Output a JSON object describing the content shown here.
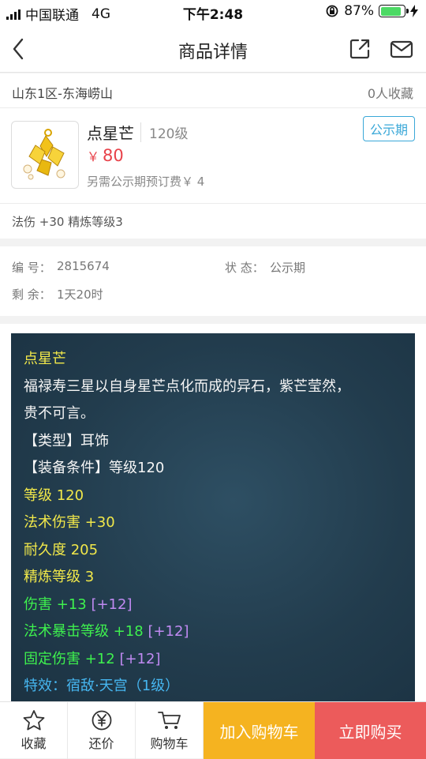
{
  "status_bar": {
    "carrier": "中国联通",
    "network": "4G",
    "time": "下午2:48",
    "battery": "87%",
    "battery_level": 0.87
  },
  "nav": {
    "title": "商品详情"
  },
  "product": {
    "server": "山东1区-东海崂山",
    "favorites": "0人收藏",
    "name": "点星芒",
    "level": "120级",
    "badge": "公示期",
    "currency": "￥",
    "price": "80",
    "fee_note": "另需公示期预订费￥ 4",
    "attrs": "法伤 +30 精炼等级3"
  },
  "info": {
    "id_label": "编 号：",
    "id_value": "2815674",
    "status_label": "状 态：",
    "status_value": "公示期",
    "remaining_label": "剩 余：",
    "remaining_value": "1天20时"
  },
  "description": {
    "title": "点星芒",
    "lore1": "福禄寿三星以自身星芒点化而成的异石，紫芒莹然，",
    "lore2": "贵不可言。",
    "type": "【类型】耳饰",
    "req": "【装备条件】等级120",
    "level": "等级 120",
    "magic_dmg": "法术伤害 +30",
    "durability": "耐久度 205",
    "refine": "精炼等级 3",
    "dmg": "伤害 +13",
    "dmg_bonus": "[+12]",
    "crit": "法术暴击等级 +18",
    "crit_bonus": "[+12]",
    "fixed": "固定伤害 +12",
    "fixed_bonus": "[+12]",
    "special": "特效：宿敌·天宫（1级）"
  },
  "tabbar": {
    "favorite": "收藏",
    "bargain": "还价",
    "cart": "购物车",
    "add_cart": "加入购物车",
    "buy_now": "立即购买"
  },
  "colors": {
    "price_red": "#e8424a",
    "badge_blue": "#3aa8d8",
    "add_cart_bg": "#f5b320",
    "buy_bg": "#ec5b5b",
    "desc_bg": "#223c4d",
    "desc_yellow": "#f1e84a",
    "desc_green": "#3ef14e",
    "desc_purple": "#c08af2",
    "desc_blue": "#46b6f0"
  }
}
